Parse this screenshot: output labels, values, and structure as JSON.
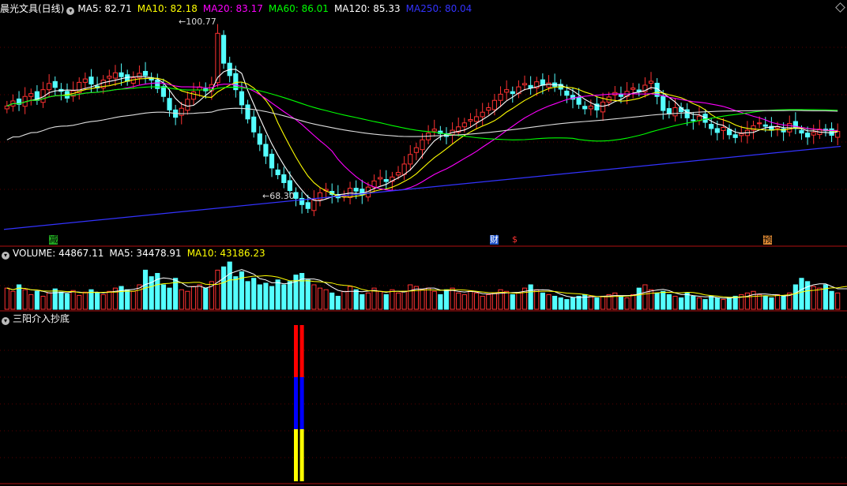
{
  "main_legend": {
    "title": "晨光文具(日线)",
    "items": [
      {
        "label": "MA5: 82.71",
        "color": "#ffffff"
      },
      {
        "label": "MA10: 82.18",
        "color": "#ffff00"
      },
      {
        "label": "MA20: 83.17",
        "color": "#ff00ff"
      },
      {
        "label": "MA60: 86.01",
        "color": "#00ff00"
      },
      {
        "label": "MA120: 85.33",
        "color": "#ffffff"
      },
      {
        "label": "MA250: 80.04",
        "color": "#3333ff"
      }
    ]
  },
  "volume_legend": {
    "title": "VOLUME: 44867.11",
    "items": [
      {
        "label": "MA5: 34478.91",
        "color": "#ffffff"
      },
      {
        "label": "MA10: 43186.23",
        "color": "#ffff00"
      }
    ]
  },
  "indicator_legend": {
    "title": "三阳介入抄底"
  },
  "price_labels": {
    "high": "100.77",
    "low": "68.30"
  },
  "event_flags": [
    {
      "text": "减",
      "color": "#000000",
      "bg": "#22aa22"
    },
    {
      "text": "财",
      "color": "#ffffff",
      "bg": "#2255cc"
    },
    {
      "text": "$",
      "color": "#ff3333",
      "bg": "transparent"
    },
    {
      "text": "预",
      "color": "#000000",
      "bg": "#dd8833"
    }
  ],
  "chart_data": {
    "type": "candlestick",
    "price_range": [
      64.0,
      103.5
    ],
    "high": 100.77,
    "low": 68.3,
    "closes": [
      87.2,
      88.1,
      87.5,
      88.9,
      89.4,
      88.2,
      90.1,
      91.2,
      90.5,
      89.8,
      88.6,
      89.9,
      91.4,
      92.0,
      91.1,
      90.4,
      91.8,
      92.5,
      93.1,
      92.4,
      91.6,
      92.2,
      93.0,
      92.6,
      91.8,
      90.3,
      88.9,
      86.5,
      85.2,
      86.8,
      88.4,
      89.7,
      90.6,
      89.9,
      91.0,
      100.1,
      94.8,
      92.6,
      90.1,
      87.4,
      84.9,
      82.6,
      80.4,
      78.3,
      76.2,
      75.0,
      73.6,
      72.2,
      70.8,
      69.7,
      69.0,
      70.6,
      71.8,
      72.4,
      71.5,
      70.9,
      71.3,
      72.6,
      72.1,
      71.4,
      72.8,
      73.9,
      74.5,
      73.8,
      74.6,
      75.4,
      76.9,
      78.6,
      79.8,
      81.2,
      82.4,
      83.1,
      82.3,
      81.8,
      82.9,
      83.5,
      84.2,
      84.8,
      85.3,
      86.1,
      86.9,
      88.2,
      89.3,
      90.1,
      89.4,
      90.6,
      91.2,
      90.4,
      91.5,
      90.9,
      91.3,
      90.7,
      90.2,
      89.1,
      88.4,
      87.5,
      86.7,
      87.2,
      86.5,
      87.9,
      88.8,
      89.6,
      88.9,
      89.8,
      90.4,
      89.7,
      90.9,
      91.6,
      88.9,
      86.4,
      85.8,
      86.9,
      86.2,
      85.1,
      84.6,
      85.4,
      84.3,
      83.2,
      82.5,
      83.4,
      82.1,
      81.6,
      82.3,
      82.9,
      83.7,
      84.2,
      83.6,
      82.9,
      83.5,
      82.6,
      84.1,
      83.2,
      82.4,
      81.7,
      82.5,
      83.1,
      82.8,
      82.0,
      82.7
    ],
    "ma250": {
      "start": 65.3,
      "end": 80.04
    },
    "volume": {
      "range": [
        0,
        60000
      ],
      "values": [
        26000,
        22000,
        30000,
        24000,
        18000,
        22000,
        16000,
        20000,
        25000,
        21000,
        19000,
        23000,
        17000,
        21000,
        24000,
        20000,
        18000,
        22000,
        26000,
        28000,
        24000,
        22000,
        30000,
        48000,
        40000,
        44000,
        30000,
        26000,
        38000,
        24000,
        22000,
        28000,
        30000,
        26000,
        34000,
        48000,
        52000,
        58000,
        40000,
        46000,
        34000,
        38000,
        30000,
        32000,
        28000,
        36000,
        30000,
        34000,
        42000,
        44000,
        36000,
        30000,
        26000,
        24000,
        20000,
        16000,
        22000,
        28000,
        24000,
        18000,
        20000,
        26000,
        22000,
        18000,
        24000,
        20000,
        22000,
        30000,
        28000,
        24000,
        26000,
        22000,
        18000,
        24000,
        26000,
        20000,
        18000,
        22000,
        20000,
        16000,
        18000,
        20000,
        24000,
        22000,
        18000,
        20000,
        26000,
        30000,
        24000,
        20000,
        18000,
        16000,
        14000,
        12000,
        14000,
        16000,
        18000,
        16000,
        14000,
        16000,
        18000,
        20000,
        16000,
        14000,
        18000,
        26000,
        30000,
        24000,
        20000,
        22000,
        18000,
        16000,
        14000,
        20000,
        16000,
        14000,
        12000,
        16000,
        14000,
        12000,
        14000,
        16000,
        18000,
        20000,
        22000,
        18000,
        16000,
        14000,
        18000,
        16000,
        20000,
        30000,
        38000,
        34000,
        28000,
        26000,
        30000,
        22000,
        20000,
        28000,
        26000
      ]
    },
    "indicator": {
      "bars": [
        {
          "index": 48,
          "segments": [
            "#ffff00",
            "#0000ff",
            "#ff0000"
          ]
        },
        {
          "index": 49,
          "segments": [
            "#ffff00",
            "#0000ff",
            "#ff0000"
          ]
        }
      ]
    }
  }
}
